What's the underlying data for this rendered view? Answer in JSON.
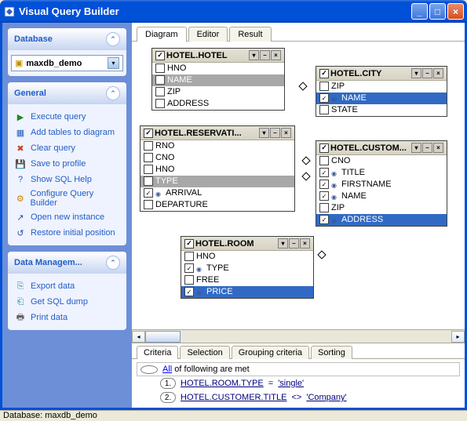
{
  "window": {
    "title": "Visual Query Builder"
  },
  "sidebar": {
    "database": {
      "title": "Database",
      "selected": "maxdb_demo"
    },
    "general": {
      "title": "General",
      "items": [
        {
          "label": "Execute query",
          "icon": "▶",
          "color": "#1f8a1f"
        },
        {
          "label": "Add tables to diagram",
          "icon": "▦",
          "color": "#1f5fbf"
        },
        {
          "label": "Clear query",
          "icon": "✖",
          "color": "#d04020"
        },
        {
          "label": "Save to profile",
          "icon": "💾",
          "color": "#d08000"
        },
        {
          "label": "Show SQL Help",
          "icon": "?",
          "color": "#2050d0"
        },
        {
          "label": "Configure Query Builder",
          "icon": "⚙",
          "color": "#d08000"
        },
        {
          "label": "Open new instance",
          "icon": "↗",
          "color": "#2050a0"
        },
        {
          "label": "Restore initial position",
          "icon": "↺",
          "color": "#2050a0"
        }
      ]
    },
    "dataman": {
      "title": "Data Managem...",
      "items": [
        {
          "label": "Export data",
          "icon": "⎘",
          "color": "#2090b0"
        },
        {
          "label": "Get SQL dump",
          "icon": "⎗",
          "color": "#2090b0"
        },
        {
          "label": "Print data",
          "icon": "🖶",
          "color": "#606060"
        }
      ]
    }
  },
  "tabs": {
    "main": [
      "Diagram",
      "Editor",
      "Result"
    ],
    "active": 0
  },
  "tables": {
    "hotel": {
      "title": "HOTEL.HOTEL",
      "columns": [
        {
          "name": "HNO",
          "checked": false
        },
        {
          "name": "NAME",
          "checked": false,
          "sel": true
        },
        {
          "name": "ZIP",
          "checked": false
        },
        {
          "name": "ADDRESS",
          "checked": false
        }
      ]
    },
    "reservation": {
      "title": "HOTEL.RESERVATI...",
      "columns": [
        {
          "name": "RNO",
          "checked": false
        },
        {
          "name": "CNO",
          "checked": false
        },
        {
          "name": "HNO",
          "checked": false
        },
        {
          "name": "TYPE",
          "checked": false,
          "sel": true
        },
        {
          "name": "ARRIVAL",
          "checked": true,
          "sort": true
        },
        {
          "name": "DEPARTURE",
          "checked": false
        }
      ]
    },
    "room": {
      "title": "HOTEL.ROOM",
      "columns": [
        {
          "name": "HNO",
          "checked": false
        },
        {
          "name": "TYPE",
          "checked": true,
          "sort": true
        },
        {
          "name": "FREE",
          "checked": false
        },
        {
          "name": "PRICE",
          "checked": true,
          "sort": true,
          "hot": true
        }
      ]
    },
    "city": {
      "title": "HOTEL.CITY",
      "columns": [
        {
          "name": "ZIP",
          "checked": false
        },
        {
          "name": "NAME",
          "checked": true,
          "sort": true,
          "hot": true
        },
        {
          "name": "STATE",
          "checked": false
        }
      ]
    },
    "customer": {
      "title": "HOTEL.CUSTOM...",
      "columns": [
        {
          "name": "CNO",
          "checked": false
        },
        {
          "name": "TITLE",
          "checked": true,
          "sort": true
        },
        {
          "name": "FIRSTNAME",
          "checked": true,
          "sort": true
        },
        {
          "name": "NAME",
          "checked": true,
          "sort": true
        },
        {
          "name": "ZIP",
          "checked": false
        },
        {
          "name": "ADDRESS",
          "checked": true,
          "sort": true,
          "hot": true
        }
      ]
    }
  },
  "bottomTabs": {
    "items": [
      "Criteria",
      "Selection",
      "Grouping criteria",
      "Sorting"
    ],
    "active": 0
  },
  "criteria": {
    "rootAll": "All",
    "rootRest": "of following are met",
    "rows": [
      {
        "n": "1.",
        "field": "HOTEL.ROOM.TYPE",
        "op": "=",
        "val": "'single'"
      },
      {
        "n": "2.",
        "field": "HOTEL.CUSTOMER.TITLE",
        "op": "<>",
        "val": "'Company'"
      }
    ]
  },
  "statusbar": "Database: maxdb_demo"
}
